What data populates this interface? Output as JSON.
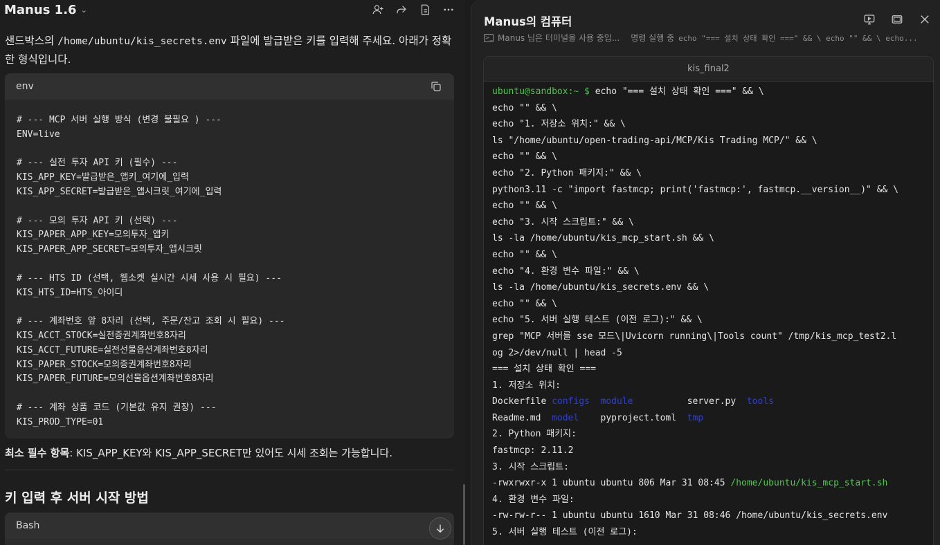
{
  "left": {
    "app_title": "Manus 1.6",
    "intro_part1": "샌드박스의 ",
    "intro_path": "/home/ubuntu/kis_secrets.env",
    "intro_part2": " 파일에 발급받은 키를 입력해 주세요. 아래가 정확한 형식입니다.",
    "code_lang": "env",
    "code_lines": [
      "# --- MCP 서버 실행 방식 (변경 불필요 ) ---",
      "ENV=live",
      "",
      "# --- 실전 투자 API 키 (필수) ---",
      "KIS_APP_KEY=발급받은_앱키_여기에_입력",
      "KIS_APP_SECRET=발급받은_앱시크릿_여기에_입력",
      "",
      "# --- 모의 투자 API 키 (선택) ---",
      "KIS_PAPER_APP_KEY=모의투자_앱키",
      "KIS_PAPER_APP_SECRET=모의투자_앱시크릿",
      "",
      "# --- HTS ID (선택, 웹소켓 실시간 시세 사용 시 필요) ---",
      "KIS_HTS_ID=HTS_아이디",
      "",
      "# --- 계좌번호 앞 8자리 (선택, 주문/잔고 조회 시 필요) ---",
      "KIS_ACCT_STOCK=실전증권계좌번호8자리",
      "KIS_ACCT_FUTURE=실전선물옵션계좌번호8자리",
      "KIS_PAPER_STOCK=모의증권계좌번호8자리",
      "KIS_PAPER_FUTURE=모의선물옵션계좌번호8자리",
      "",
      "# --- 계좌 상품 코드 (기본값 유지 권장) ---",
      "KIS_PROD_TYPE=01"
    ],
    "note_bold": "최소 필수 항목",
    "note_rest": ": KIS_APP_KEY와 KIS_APP_SECRET만 있어도 시세 조회는 가능합니다.",
    "section_heading": "키 입력 후 서버 시작 방법",
    "code2_lang": "Bash"
  },
  "right": {
    "title": "Manus의 컴퓨터",
    "status_label": "Manus 님은 터미널을 사용 중입...",
    "status_action": "명령 실행 중",
    "status_cmd": "echo \"=== 설치 상태 확인 ===\" && \\ echo \"\" && \\ echo...",
    "terminal_tab": "kis_final2",
    "prompt": "ubuntu@sandbox:~ $",
    "lines": [
      " echo \"=== 설치 상태 확인 ===\" && \\",
      "echo \"\" && \\",
      "echo \"1. 저장소 위치:\" && \\",
      "ls \"/home/ubuntu/open-trading-api/MCP/Kis Trading MCP/\" && \\",
      "echo \"\" && \\",
      "echo \"2. Python 패키지:\" && \\",
      "python3.11 -c \"import fastmcp; print('fastmcp:', fastmcp.__version__)\" && \\",
      "echo \"\" && \\",
      "echo \"3. 시작 스크립트:\" && \\",
      "ls -la /home/ubuntu/kis_mcp_start.sh && \\",
      "echo \"\" && \\",
      "echo \"4. 환경 변수 파일:\" && \\",
      "ls -la /home/ubuntu/kis_secrets.env && \\",
      "echo \"\" && \\",
      "echo \"5. 서버 실행 테스트 (이전 로그):\" && \\",
      "grep \"MCP 서버를 sse 모드\\|Uvicorn running\\|Tools count\" /tmp/kis_mcp_test2.l",
      "og 2>/dev/null | head -5",
      "=== 설치 상태 확인 ===",
      "1. 저장소 위치:"
    ],
    "ls_row1": [
      "Dockerfile",
      "configs",
      "module",
      "server.py",
      "tools"
    ],
    "ls_row2": [
      "Readme.md",
      "model",
      "pyproject.toml",
      "tmp"
    ],
    "out_pkg_header": "2. Python 패키지:",
    "out_pkg": "fastmcp: 2.11.2",
    "out_script_header": "3. 시작 스크립트:",
    "out_script_prefix": "-rwxrwxr-x 1 ubuntu ubuntu 806 Mar 31 08:45 ",
    "out_script_path": "/home/ubuntu/kis_mcp_start.sh",
    "out_env_header": "4. 환경 변수 파일:",
    "out_env": "-rw-rw-r-- 1 ubuntu ubuntu 1610 Mar 31 08:46 /home/ubuntu/kis_secrets.env",
    "out_test_header": "5. 서버 실행 테스트 (이전 로그):"
  }
}
